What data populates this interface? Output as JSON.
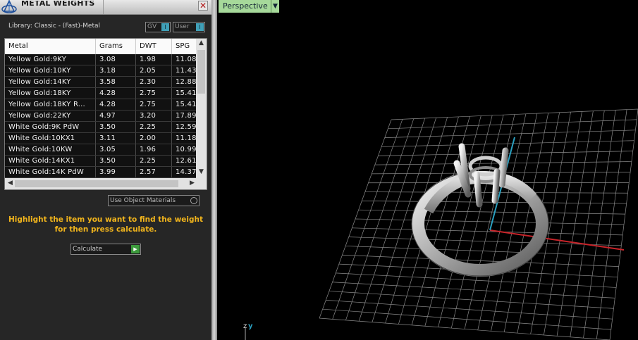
{
  "panel": {
    "title": "METAL WEIGHTS",
    "library_label": "Library: Classic - (Fast)-Metal",
    "toggles": [
      {
        "label": "GV"
      },
      {
        "label": "User"
      }
    ],
    "columns": [
      "Metal",
      "Grams",
      "DWT",
      "SPG"
    ],
    "rows": [
      [
        "Yellow Gold:9KY",
        "3.08",
        "1.98",
        "11.08"
      ],
      [
        "Yellow Gold:10KY",
        "3.18",
        "2.05",
        "11.43"
      ],
      [
        "Yellow Gold:14KY",
        "3.58",
        "2.30",
        "12.88"
      ],
      [
        "Yellow Gold:18KY",
        "4.28",
        "2.75",
        "15.41"
      ],
      [
        "Yellow Gold:18KY R...",
        "4.28",
        "2.75",
        "15.41"
      ],
      [
        "Yellow Gold:22KY",
        "4.97",
        "3.20",
        "17.89"
      ],
      [
        "White Gold:9K PdW",
        "3.50",
        "2.25",
        "12.59"
      ],
      [
        "White Gold:10KX1",
        "3.11",
        "2.00",
        "11.18"
      ],
      [
        "White Gold:10KW",
        "3.05",
        "1.96",
        "10.99"
      ],
      [
        "White Gold:14KX1",
        "3.50",
        "2.25",
        "12.61"
      ],
      [
        "White Gold:14K PdW",
        "3.99",
        "2.57",
        "14.37"
      ]
    ],
    "use_object_materials": "Use Object Materials",
    "hint": "Highlight the item you want to find the weight for then press calculate.",
    "calculate": "Calculate",
    "close_glyph": "✕",
    "toggle_glyph": "I",
    "go_glyph": "▶"
  },
  "viewport": {
    "label": "Perspective",
    "dropdown_glyph": "▼",
    "axis_z": "z",
    "axis_y": "y"
  },
  "colors": {
    "hint": "#f2b51c",
    "viewport_label_bg": "#a6d99a",
    "axis_x": "#c8242a",
    "axis_y": "#2aa0c0",
    "grid": "#8a8a8a"
  },
  "icons": [
    "app-logo-icon",
    "close-icon",
    "dropdown-arrow-icon",
    "play-icon",
    "scroll-up-icon",
    "scroll-down-icon",
    "scroll-left-icon",
    "scroll-right-icon",
    "radio-icon"
  ]
}
